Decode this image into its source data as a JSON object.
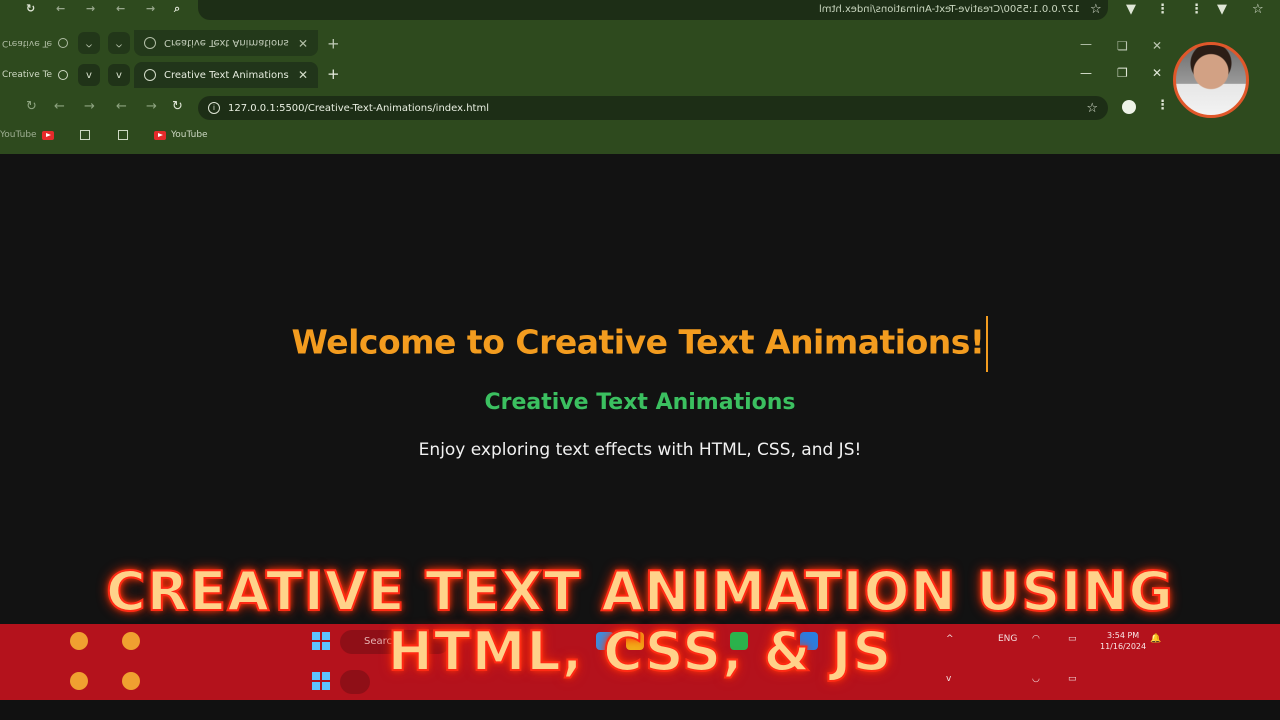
{
  "browser": {
    "mirrored_url": "127.0.0.1:5500/Creative-Text-Animations/index.html",
    "tab_title": "Creative Text Animations",
    "small_tab_title": "Creative Te",
    "url": "127.0.0.1:5500/Creative-Text-Animations/index.html",
    "bookmarks": [
      {
        "label": "YouTube"
      },
      {
        "label": "YouTube"
      }
    ]
  },
  "page": {
    "headline": "Welcome to Creative Text Animations!",
    "subhead": "Creative Text Animations",
    "tagline": "Enjoy exploring text effects with HTML, CSS, and JS!"
  },
  "taskbar": {
    "search_placeholder": "Search",
    "lang": "ENG",
    "time": "3:54 PM",
    "date": "11/16/2024"
  },
  "banner": {
    "line1": "CREATIVE TEXT ANIMATION USING",
    "line2": "HTML, CSS, & JS"
  },
  "colors": {
    "chrome": "#2e4a1e",
    "headline": "#f39c1f",
    "subhead": "#3bc060",
    "taskbar": "#b4121c",
    "banner_stroke": "#ff2a14"
  },
  "icons": [
    "reload-icon",
    "back-icon",
    "forward-icon",
    "info-icon",
    "star-icon",
    "profile-icon",
    "menu-icon",
    "globe-icon",
    "close-icon",
    "plus-icon",
    "minimize-icon",
    "maximize-icon",
    "windows-icon",
    "search-icon",
    "youtube-icon",
    "apps-grid-icon"
  ]
}
